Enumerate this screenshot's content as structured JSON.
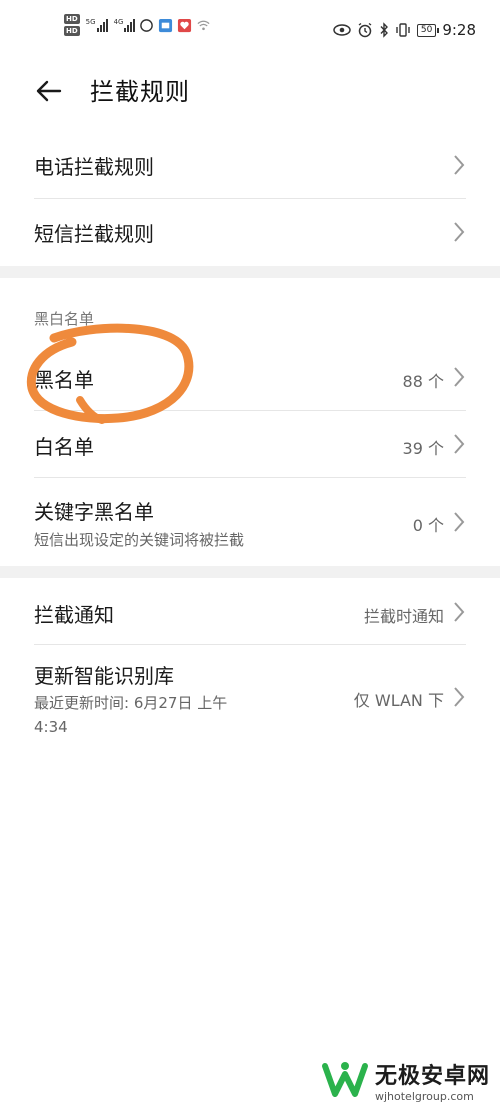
{
  "status_bar": {
    "hd_badges": [
      "HD",
      "HD"
    ],
    "net_labels": [
      "5G",
      "4G"
    ],
    "battery": "50",
    "time": "9:28",
    "icons": [
      "eye-icon",
      "alarm-icon",
      "bluetooth-icon",
      "vibrate-icon"
    ]
  },
  "header": {
    "title": "拦截规则"
  },
  "section1": {
    "items": [
      {
        "label": "电话拦截规则"
      },
      {
        "label": "短信拦截规则"
      }
    ]
  },
  "section2": {
    "header": "黑白名单",
    "items": [
      {
        "label": "黑名单",
        "value": "88 个"
      },
      {
        "label": "白名单",
        "value": "39 个"
      },
      {
        "label": "关键字黑名单",
        "subtitle": "短信出现设定的关键词将被拦截",
        "value": "0 个"
      }
    ]
  },
  "section3": {
    "items": [
      {
        "label": "拦截通知",
        "value": "拦截时通知"
      },
      {
        "label": "更新智能识别库",
        "subtitle_line1": "最近更新时间: 6月27日 上午",
        "subtitle_line2": "4:34",
        "value": "仅 WLAN 下"
      }
    ]
  },
  "watermark": {
    "name": "无极安卓网",
    "url": "wjhotelgroup.com"
  },
  "colors": {
    "annotation": "#ef8a3c",
    "section_gap": "#f1f1f1",
    "watermark_green": "#2bb24c"
  }
}
